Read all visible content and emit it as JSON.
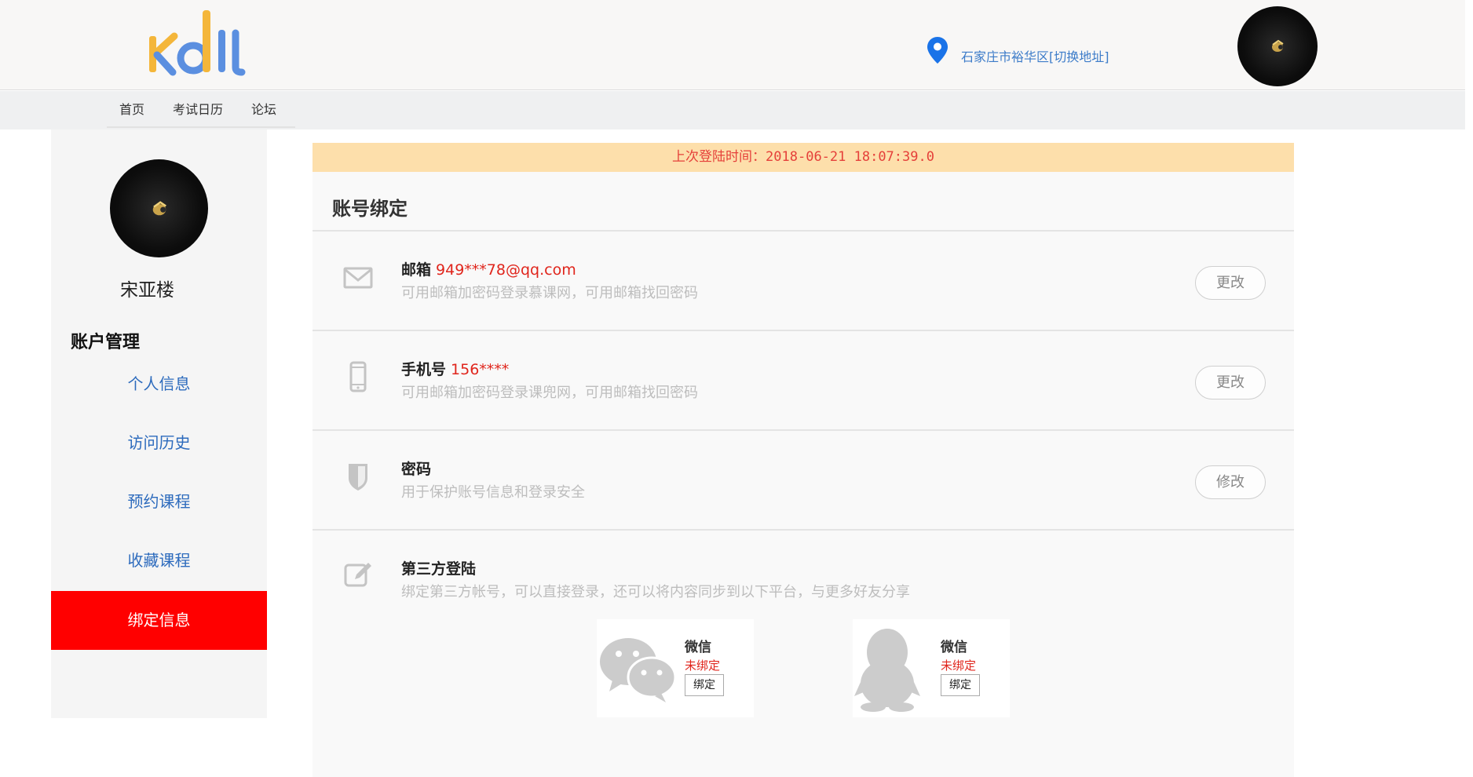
{
  "header": {
    "logo_text": "kdil",
    "location": "石家庄市裕华区[切换地址]",
    "avatar_icon": "user-avatar"
  },
  "nav": {
    "items": [
      {
        "label": "首页"
      },
      {
        "label": "考试日历"
      },
      {
        "label": "论坛"
      }
    ]
  },
  "sidebar": {
    "user_name": "宋亚楼",
    "section_title": "账户管理",
    "items": [
      {
        "label": "个人信息",
        "active": false
      },
      {
        "label": "访问历史",
        "active": false
      },
      {
        "label": "预约课程",
        "active": false
      },
      {
        "label": "收藏课程",
        "active": false
      },
      {
        "label": "绑定信息",
        "active": true
      }
    ],
    "active_color": "#ff0000"
  },
  "main": {
    "notice": "上次登陆时间：2018-06-21 18:07:39.0",
    "title": "账号绑定",
    "rows": [
      {
        "icon": "mail-icon",
        "title": "邮箱",
        "value": "949***78@qq.com",
        "desc": "可用邮箱加密码登录慕课网，可用邮箱找回密码",
        "button": "更改"
      },
      {
        "icon": "phone-icon",
        "title": "手机号",
        "value": "156****",
        "desc": "可用邮箱加密码登录课兜网，可用邮箱找回密码",
        "button": "更改"
      },
      {
        "icon": "shield-icon",
        "title": "密码",
        "value": "",
        "desc": "用于保护账号信息和登录安全",
        "button": "修改"
      },
      {
        "icon": "edit-icon",
        "title": "第三方登陆",
        "value": "",
        "desc": "绑定第三方帐号，可以直接登录，还可以将内容同步到以下平台，与更多好友分享",
        "button": ""
      }
    ],
    "third_party": [
      {
        "icon": "wechat-icon",
        "name": "微信",
        "status": "未绑定",
        "button": "绑定"
      },
      {
        "icon": "qq-icon",
        "name": "微信",
        "status": "未绑定",
        "button": "绑定"
      }
    ]
  },
  "colors": {
    "notice_bg": "#fddfab",
    "notice_text": "#e5403a",
    "link_blue": "#2d6bbd",
    "highlight_red": "#e0251c"
  }
}
